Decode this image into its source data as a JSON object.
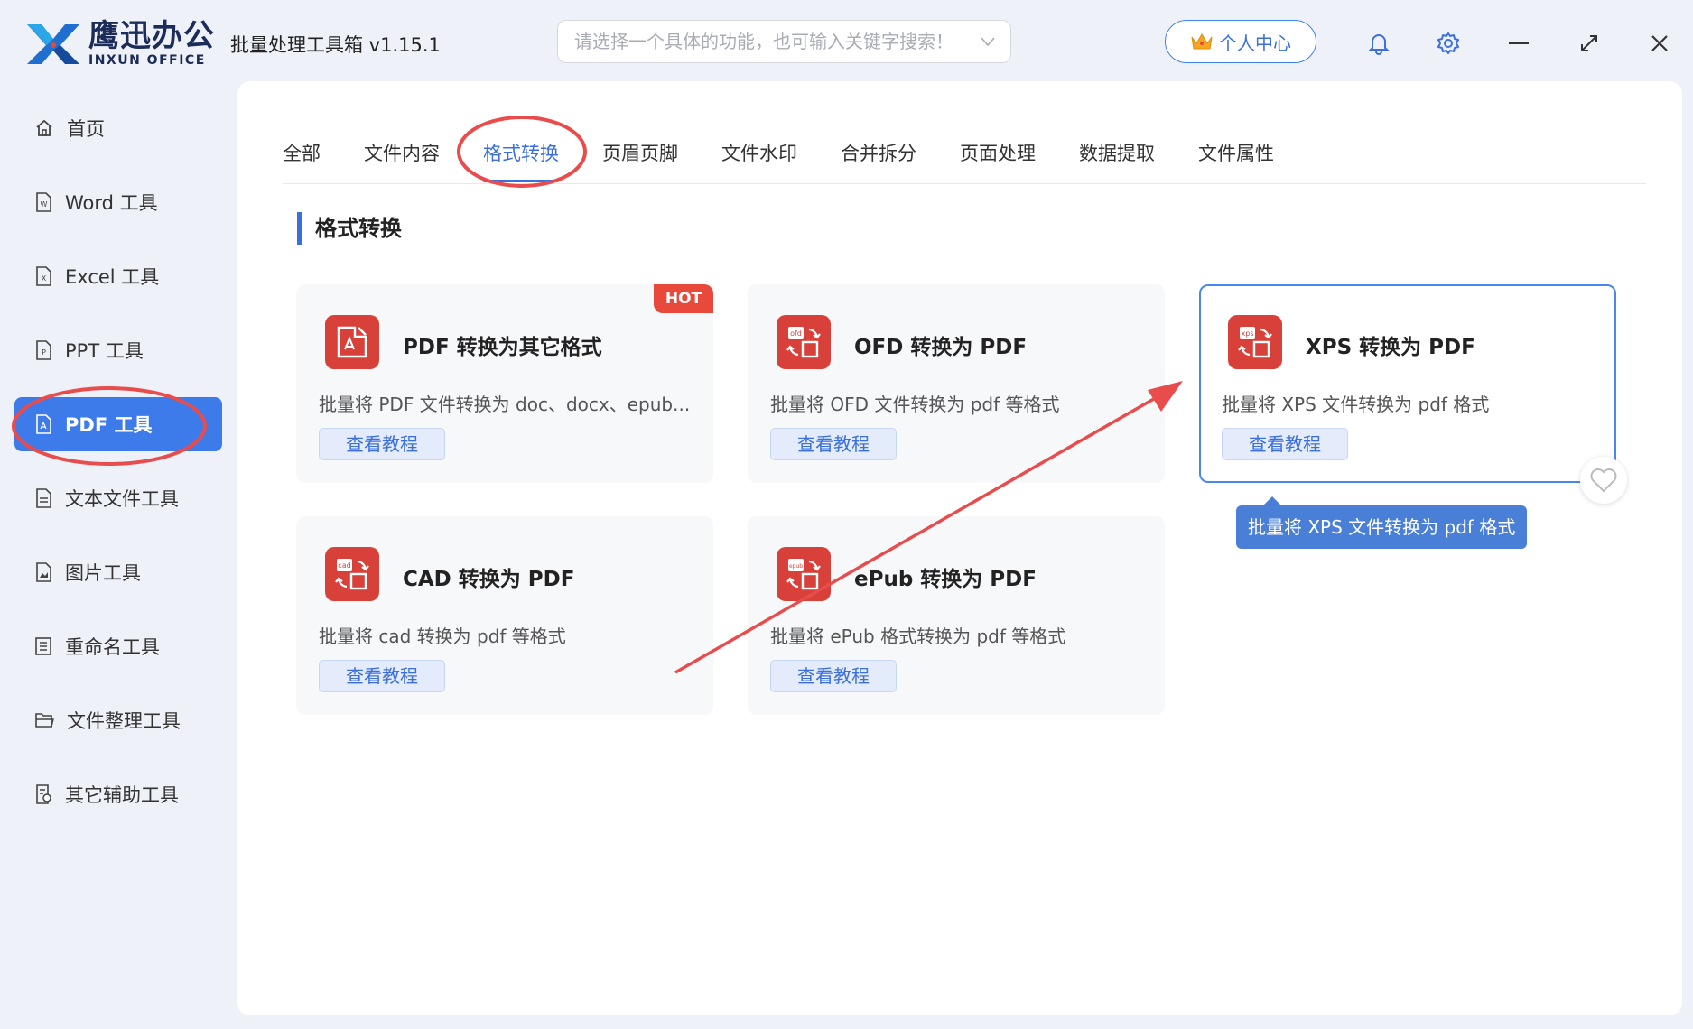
{
  "logo": {
    "cn": "鹰迅办公",
    "en": "INXUN OFFICE"
  },
  "app_title": "批量处理工具箱 v1.15.1",
  "search": {
    "placeholder": "请选择一个具体的功能，也可输入关键字搜索！"
  },
  "user_center": "个人中心",
  "sidebar": {
    "items": [
      {
        "label": "首页",
        "icon": "home-icon"
      },
      {
        "label": "Word 工具",
        "icon": "word-file-icon"
      },
      {
        "label": "Excel 工具",
        "icon": "excel-file-icon"
      },
      {
        "label": "PPT 工具",
        "icon": "ppt-file-icon"
      },
      {
        "label": "PDF 工具",
        "icon": "pdf-file-icon",
        "active": true
      },
      {
        "label": "文本文件工具",
        "icon": "text-file-icon"
      },
      {
        "label": "图片工具",
        "icon": "image-file-icon"
      },
      {
        "label": "重命名工具",
        "icon": "rename-icon"
      },
      {
        "label": "文件整理工具",
        "icon": "folder-icon"
      },
      {
        "label": "其它辅助工具",
        "icon": "misc-tools-icon"
      }
    ]
  },
  "tabs": [
    {
      "label": "全部"
    },
    {
      "label": "文件内容"
    },
    {
      "label": "格式转换",
      "active": true
    },
    {
      "label": "页眉页脚"
    },
    {
      "label": "文件水印"
    },
    {
      "label": "合并拆分"
    },
    {
      "label": "页面处理"
    },
    {
      "label": "数据提取"
    },
    {
      "label": "文件属性"
    }
  ],
  "section_title": "格式转换",
  "cards": [
    {
      "title": "PDF 转换为其它格式",
      "desc": "批量将 PDF 文件转换为 doc、docx、epub...",
      "button": "查看教程",
      "badge": "HOT",
      "icon": "pdf-convert-icon"
    },
    {
      "title": "OFD 转换为 PDF",
      "desc": "批量将 OFD 文件转换为 pdf 等格式",
      "button": "查看教程",
      "icon": "ofd-convert-icon",
      "icon_tag": "ofd"
    },
    {
      "title": "XPS 转换为 PDF",
      "desc": "批量将 XPS 文件转换为 pdf 格式",
      "button": "查看教程",
      "icon": "xps-convert-icon",
      "icon_tag": "xps",
      "selected": true
    },
    {
      "title": "CAD 转换为 PDF",
      "desc": "批量将 cad 转换为 pdf 等格式",
      "button": "查看教程",
      "icon": "cad-convert-icon",
      "icon_tag": "cad"
    },
    {
      "title": "ePub 转换为 PDF",
      "desc": "批量将 ePub 格式转换为 pdf 等格式",
      "button": "查看教程",
      "icon": "epub-convert-icon",
      "icon_tag": "epub"
    }
  ],
  "tooltip": "批量将 XPS 文件转换为 pdf 格式",
  "colors": {
    "accent": "#3e7bea",
    "card_icon": "#d8413a",
    "annotation_red": "#e84c4c",
    "hot_badge": "#e8493a"
  }
}
